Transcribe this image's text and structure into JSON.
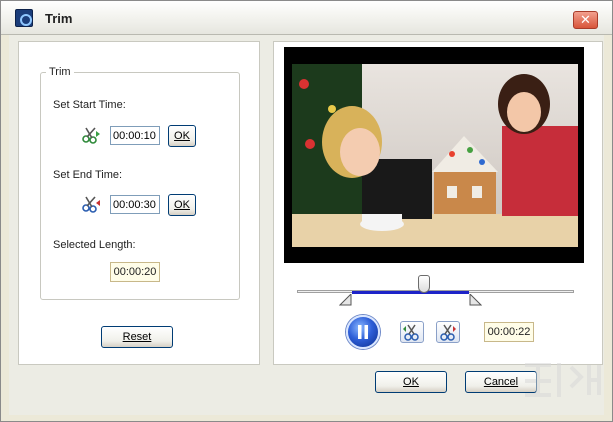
{
  "window": {
    "title": "Trim",
    "close_glyph": "✕"
  },
  "trim": {
    "group_label": "Trim",
    "start_label": "Set Start Time:",
    "start_value": "00:00:10",
    "start_ok": "OK",
    "end_label": "Set End Time:",
    "end_value": "00:00:30",
    "end_ok": "OK",
    "length_label": "Selected Length:",
    "length_value": "00:00:20",
    "reset_label": "Reset"
  },
  "player": {
    "current_time": "00:00:22",
    "state": "playing",
    "playhead_fraction": 0.46,
    "selection_start_fraction": 0.2,
    "selection_end_fraction": 0.62
  },
  "footer": {
    "ok_label": "OK",
    "cancel_label": "Cancel"
  },
  "icons": {
    "app": "film-icon",
    "start_marker": "scissors-start-icon",
    "end_marker": "scissors-end-icon",
    "pause": "pause-icon",
    "cut_left": "scissors-left-icon",
    "cut_right": "scissors-right-icon"
  },
  "colors": {
    "selection": "#1d23c8",
    "play_button": "#2e5fd8",
    "readout_bg": "#fffde8"
  }
}
